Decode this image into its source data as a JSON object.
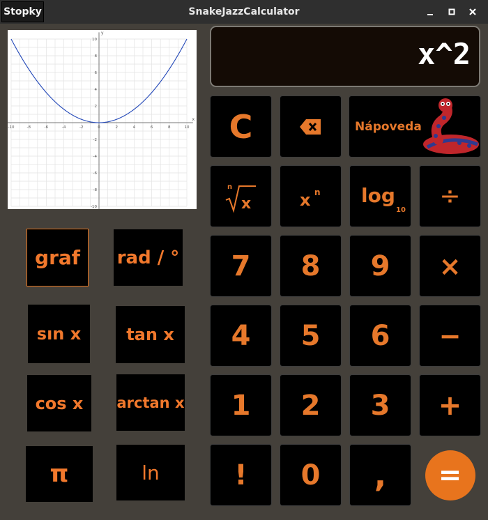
{
  "window": {
    "title": "SnakeJazzCalculator",
    "stopky": "Stopky",
    "minimize": "_",
    "maximize": "□",
    "close": "×"
  },
  "display": {
    "expression": "x^2"
  },
  "graph": {
    "x_ticks": [
      "-10",
      "-8",
      "-6",
      "-4",
      "-2",
      "0",
      "2",
      "4",
      "6",
      "8",
      "10"
    ],
    "y_ticks": [
      "10",
      "8",
      "6",
      "4",
      "2",
      "-2",
      "-4",
      "-6",
      "-8",
      "-10"
    ],
    "xlabel": "x",
    "ylabel": "y"
  },
  "left_buttons": {
    "graf": "graf",
    "radDeg": "rad / °",
    "sin": "sın x",
    "tan": "tan x",
    "cos": "cos x",
    "arctan": "arctan x",
    "pi": "π",
    "ln": "ln"
  },
  "keys": {
    "clear": "C",
    "backspace": "⌫",
    "help": "Nápoveda",
    "root_index": "n",
    "root_x": "x",
    "power_base": "x",
    "power_exp": "n",
    "log": "log",
    "log_base": "10",
    "divide": "÷",
    "d7": "7",
    "d8": "8",
    "d9": "9",
    "multiply": "×",
    "d4": "4",
    "d5": "5",
    "d6": "6",
    "minus": "−",
    "d1": "1",
    "d2": "2",
    "d3": "3",
    "plus": "+",
    "factorial": "!",
    "d0": "0",
    "comma": ",",
    "equals": "="
  },
  "colors": {
    "accent": "#e8741d",
    "background": "#44403a",
    "key": "#000000"
  }
}
